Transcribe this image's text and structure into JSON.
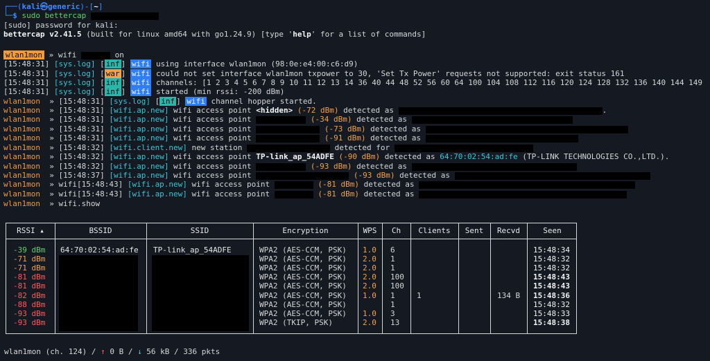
{
  "prompt": {
    "user_host": "kali㉿generic",
    "cwd": "~",
    "command": "sudo bettercap"
  },
  "sudo_prompt": "[sudo] password for kali:",
  "banner": {
    "name_version": "bettercap v2.41.5",
    "build": " (built for linux amd64 with go1.24.9) [type '",
    "help": "help",
    "help_suffix": "' for a list of commands]"
  },
  "iface_name": "wlan1mon",
  "cmd_wifi_on": {
    "prefix": "» wifi",
    "suffix": "on"
  },
  "log_lines": [
    {
      "ts": "[15:48:31]",
      "src": "[sys.log]",
      "lvl": "inf",
      "mod": "wifi",
      "msg": " using interface wlan1mon (98:0e:e4:00:c6:d9)"
    },
    {
      "ts": "[15:48:31]",
      "src": "[sys.log]",
      "lvl": "war",
      "mod": "wifi",
      "msg": " could not set interface wlan1mon txpower to 30, 'Set Tx Power' requests not supported: exit status 161"
    },
    {
      "ts": "[15:48:31]",
      "src": "[sys.log]",
      "lvl": "inf",
      "mod": "wifi",
      "msg": " channels: [1 2 3 4 5 6 7 8 9 10 11 12 13 14 36 40 44 48 52 56 60 64 100 104 108 112 116 120 124 128 132 136 140 144 149"
    },
    {
      "ts": "[15:48:31]",
      "src": "[sys.log]",
      "lvl": "inf",
      "mod": "wifi",
      "msg": " started (min rssi: -200 dBm)"
    }
  ],
  "event_lines": {
    "l1": {
      "ts": "» [15:48:31]",
      "src": "[sys.log]",
      "lvl": "inf",
      "mod": "wifi",
      "msg": " channel hopper started."
    },
    "l2": {
      "ts": "» [15:48:31]",
      "evt": "[wifi.ap.new]",
      "pre": " wifi access point ",
      "ssid": "<hidden>",
      "rssi": " (-72 dBm)",
      "mid": " detected as "
    },
    "l3": {
      "ts": "» [15:48:31]",
      "evt": "[wifi.ap.new]",
      "pre": " wifi access point ",
      "rssi": "(-34 dBm)",
      "mid": " detected as"
    },
    "l4": {
      "ts": "» [15:48:31]",
      "evt": "[wifi.ap.new]",
      "pre": " wifi access point ",
      "rssi": "(-73 dBm)",
      "mid": " detected as"
    },
    "l5": {
      "ts": "» [15:48:31]",
      "evt": "[wifi.ap.new]",
      "pre": " wifi access point ",
      "rssi": "(-91 dBm)",
      "mid": " detected as"
    },
    "l6": {
      "ts": "» [15:48:32]",
      "evt": "[wifi.client.new]",
      "pre": " new station ",
      "mid": "detected for"
    },
    "l7": {
      "ts": "» [15:48:32]",
      "evt": "[wifi.ap.new]",
      "pre": " wifi access point ",
      "ssid": "TP-link_ap_54ADFE",
      "rssi": " (-90 dBm)",
      "mid": " detected as ",
      "mac": "64:70:02:54:ad:fe",
      "vendor": " (TP-LINK TECHNOLOGIES CO.,LTD.)."
    },
    "l8": {
      "ts": "» [15:48:32]",
      "evt": "[wifi.ap.new]",
      "pre": " wifi access point ",
      "rssi": "(-93 dBm)",
      "mid": " detected as"
    },
    "l9": {
      "ts": "» [15:48:37]",
      "evt": "[wifi.ap.new]",
      "pre": " wifi access point ",
      "rssi": "(-93 dBm)",
      "mid": " detected as"
    },
    "l10": {
      "ts": "» wifi[15:48:43]",
      "evt": "[wifi.ap.new]",
      "pre": " wifi access point ",
      "rssi": "(-81 dBm)",
      "mid": " detected as"
    },
    "l11": {
      "ts": "» wifi[15:48:43]",
      "evt": "[wifi.ap.new]",
      "pre": " wifi access point ",
      "rssi": "(-81 dBm)",
      "mid": " detected as"
    },
    "l12": {
      "cmd": "» wifi.show"
    }
  },
  "table": {
    "headers": [
      "RSSI ▴",
      "BSSID",
      "SSID",
      "Encryption",
      "WPS",
      "Ch",
      "Clients",
      "Sent",
      "Recvd",
      "Seen"
    ],
    "rows": [
      {
        "rssi": "-39 dBm",
        "bssid": "64:70:02:54:ad:fe",
        "ssid": "TP-link_ap_54ADFE",
        "enc": "WPA2 (AES-CCM, PSK)",
        "wps": "1.0",
        "ch": "6",
        "clients": "",
        "sent": "",
        "recvd": "",
        "seen": "15:48:34",
        "bold": false
      },
      {
        "rssi": "-71 dBm",
        "bssid": "",
        "ssid": "",
        "enc": "WPA2 (AES-CCM, PSK)",
        "wps": "2.0",
        "ch": "1",
        "clients": "",
        "sent": "",
        "recvd": "",
        "seen": "15:48:32",
        "bold": false
      },
      {
        "rssi": "-71 dBm",
        "bssid": "",
        "ssid": "",
        "enc": "WPA2 (AES-CCM, PSK)",
        "wps": "2.0",
        "ch": "1",
        "clients": "",
        "sent": "",
        "recvd": "",
        "seen": "15:48:32",
        "bold": false
      },
      {
        "rssi": "-81 dBm",
        "bssid": "",
        "ssid": "",
        "enc": "WPA2 (AES-CCM, PSK)",
        "wps": "2.0",
        "ch": "100",
        "clients": "",
        "sent": "",
        "recvd": "",
        "seen": "15:48:43",
        "bold": true
      },
      {
        "rssi": "-81 dBm",
        "bssid": "",
        "ssid": "",
        "enc": "WPA2 (AES-CCM, PSK)",
        "wps": "2.0",
        "ch": "100",
        "clients": "",
        "sent": "",
        "recvd": "",
        "seen": "15:48:43",
        "bold": true
      },
      {
        "rssi": "-82 dBm",
        "bssid": "",
        "ssid": "",
        "enc": "WPA2 (AES-CCM, PSK)",
        "wps": "1.0",
        "ch": "1",
        "clients": "1",
        "sent": "",
        "recvd": "134 B",
        "seen": "15:48:36",
        "bold": true
      },
      {
        "rssi": "-88 dBm",
        "bssid": "",
        "ssid": "",
        "enc": "WPA2 (AES-CCM, PSK)",
        "wps": "",
        "ch": "1",
        "clients": "",
        "sent": "",
        "recvd": "",
        "seen": "15:48:32",
        "bold": false
      },
      {
        "rssi": "-93 dBm",
        "bssid": "",
        "ssid": "",
        "enc": "WPA2 (AES-CCM, PSK)",
        "wps": "1.0",
        "ch": "3",
        "clients": "",
        "sent": "",
        "recvd": "",
        "seen": "15:48:33",
        "bold": false
      },
      {
        "rssi": "-93 dBm",
        "bssid": "",
        "ssid": "",
        "enc": "WPA2 (TKIP, PSK)",
        "wps": "2.0",
        "ch": "13",
        "clients": "",
        "sent": "",
        "recvd": "",
        "seen": "15:48:38",
        "bold": true
      }
    ]
  },
  "status": {
    "pre": "wlan1mon (ch. 124) / ",
    "up_arrow": "↑",
    "up": " 0 B / ",
    "down_arrow": "↓",
    "down": " 56 kB / 336 pkts"
  }
}
